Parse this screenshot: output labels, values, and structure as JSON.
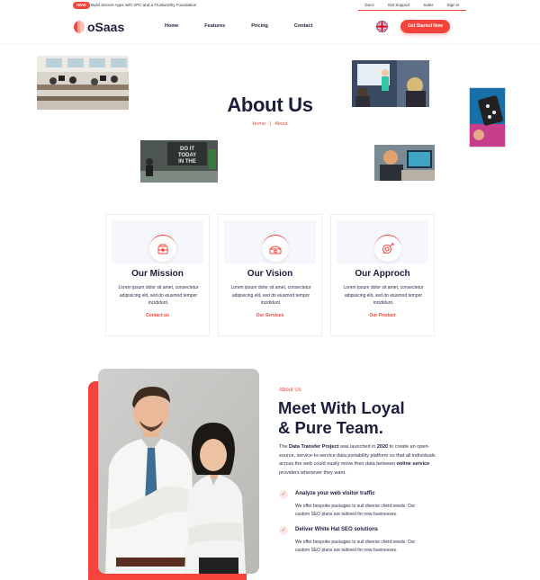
{
  "topbar": {
    "badge": "NEW",
    "notice": "Build Secure Apps with VPC and a Trustworthy Foundation",
    "links": [
      "Docs",
      "Get Support",
      "Sales",
      "Sign in"
    ]
  },
  "header": {
    "logo": "oSaas",
    "nav": [
      "Home",
      "Features",
      "Pricing",
      "Contact"
    ],
    "language_icon": "uk-flag-icon",
    "cta": "Get Started Now"
  },
  "hero": {
    "title": "About Us",
    "breadcrumb": {
      "home": "Home",
      "separator": "|",
      "current": "About"
    }
  },
  "cards": [
    {
      "title": "Our Mission",
      "text": "Lorem ipsum dolor sit amet, consectetur adipisicing elit, sed do eiusmod tempor incididunt.",
      "link": "Contact us",
      "icon": "mission-icon"
    },
    {
      "title": "Our Vision",
      "text": "Lorem ipsum dolor sit amet, consectetur adipisicing elit, sed do eiusmod tempor incididunt.",
      "link": "Our Services",
      "icon": "vision-icon"
    },
    {
      "title": "Our Approch",
      "text": "Lorem ipsum dolor sit amet, consectetur adipisicing elit, sed do eiusmod tempor incididunt.",
      "link": "Our Product",
      "icon": "approach-icon"
    }
  ],
  "team": {
    "tag": "About Us",
    "title_line1": "Meet With Loyal",
    "title_line2": "& Pure Team.",
    "intro": {
      "p1": "The ",
      "project": "Data Transfer Project",
      "p2": " was launched in ",
      "year": "2020",
      "p3": " to create an open-source, service-to-service data portability platform so that all individuals across the web could easily move their data between ",
      "service": "online service",
      "p4": " providers whenever they want."
    },
    "features": [
      {
        "title": "Analyze your web visitor traffic",
        "text": "We offer bespoke packages to suit diverse client needs. Our custom SEO plans are tailored for new businesses."
      },
      {
        "title": "Deliver White Hat SEO solutions",
        "text": "We offer bespoke packages to suit diverse client needs. Our custom SEO plans are tailored for new businesses."
      }
    ]
  },
  "colors": {
    "accent": "#f5443b",
    "heading": "#1b1e3c",
    "card_bg": "#f5f7fc"
  }
}
